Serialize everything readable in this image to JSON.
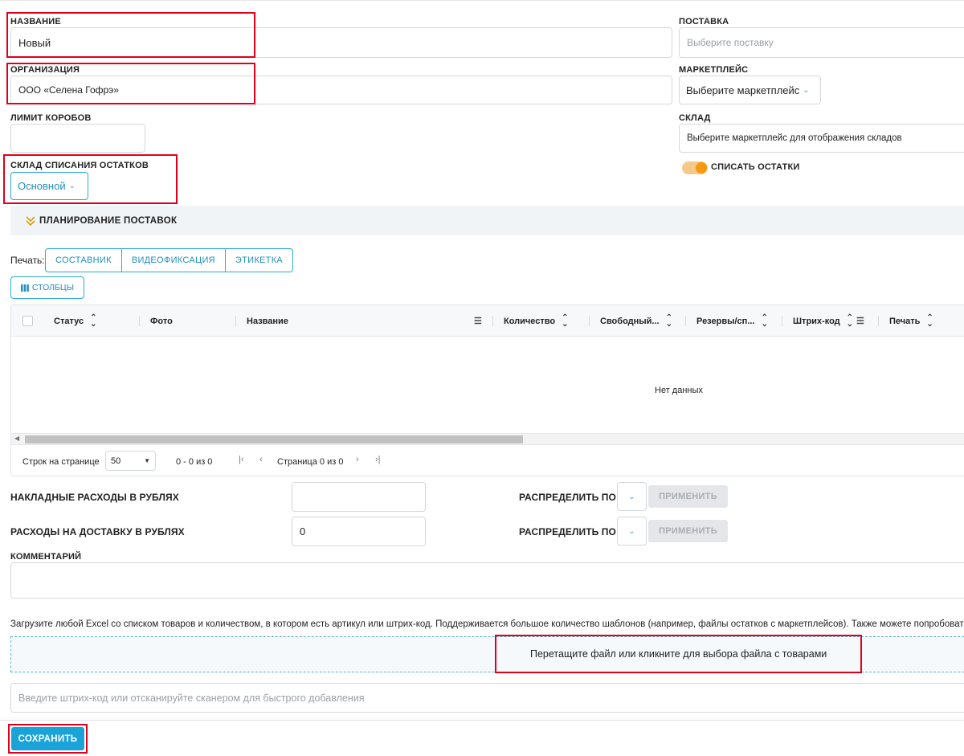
{
  "form": {
    "name_label": "НАЗВАНИЕ",
    "name_value": "Новый",
    "org_label": "ОРГАНИЗАЦИЯ",
    "org_value": "ООО «Селена Гофрэ»",
    "box_limit_label": "ЛИМИТ КОРОБОВ",
    "box_limit_value": "",
    "writeoff_wh_label": "СКЛАД СПИСАНИЯ ОСТАТКОВ",
    "writeoff_wh_value": "Основной",
    "supply_label": "ПОСТАВКА",
    "supply_placeholder": "Выберите поставку",
    "marketplace_label": "МАРКЕТПЛЕЙС",
    "marketplace_value": "Выберите маркетплейс",
    "warehouse_label": "СКЛАД",
    "warehouse_value": "Выберите маркетплейс для отображения складов",
    "writeoff_toggle_label": "СПИСАТЬ ОСТАТКИ",
    "writeoff_toggle_on": true
  },
  "planning": {
    "title": "ПЛАНИРОВАНИЕ ПОСТАВОК",
    "icon": "double-chevron-down-icon"
  },
  "print": {
    "label": "Печать:",
    "buttons": [
      "СОСТАВНИК",
      "ВИДЕОФИКСАЦИЯ",
      "ЭТИКЕТКА"
    ]
  },
  "columns_button": "СТОЛБЦЫ",
  "table": {
    "columns": [
      "Статус",
      "Фото",
      "Название",
      "Количество",
      "Свободный...",
      "Резервы/сп...",
      "Штрих-код",
      "Печать"
    ],
    "empty_text": "Нет данных",
    "rows": [],
    "scroll_fraction": 0.53
  },
  "pager": {
    "rows_label": "Строк на странице",
    "rows_value": "50",
    "range": "0 - 0 из 0",
    "page": "Страница 0 из 0"
  },
  "costs": {
    "overhead_label": "НАКЛАДНЫЕ РАСХОДЫ В РУБЛЯХ",
    "overhead_value": "",
    "delivery_label": "РАСХОДЫ НА ДОСТАВКУ В РУБЛЯХ",
    "delivery_value": "0",
    "distribute_label": "РАСПРЕДЕЛИТЬ ПО",
    "apply_label": "ПРИМЕНИТЬ"
  },
  "comment": {
    "label": "КОММЕНТАРИЙ",
    "value": ""
  },
  "upload": {
    "hint": "Загрузите любой Excel со списком товаров и количеством, в котором есть артикул или штрих-код. Поддерживается большое количество шаблонов (например, файлы остатков с маркетплейсов). Также можете попробовать сво",
    "dropzone": "Перетащите файл или кликните для выбора файла с товарами"
  },
  "barcode": {
    "placeholder": "Введите штрих-код или отсканируйте сканером для быстрого добавления"
  },
  "save_label": "СОХРАНИТЬ",
  "colors": {
    "accent": "#1aa3d9",
    "highlight": "#e0001b",
    "toggle": "#f59a10"
  }
}
